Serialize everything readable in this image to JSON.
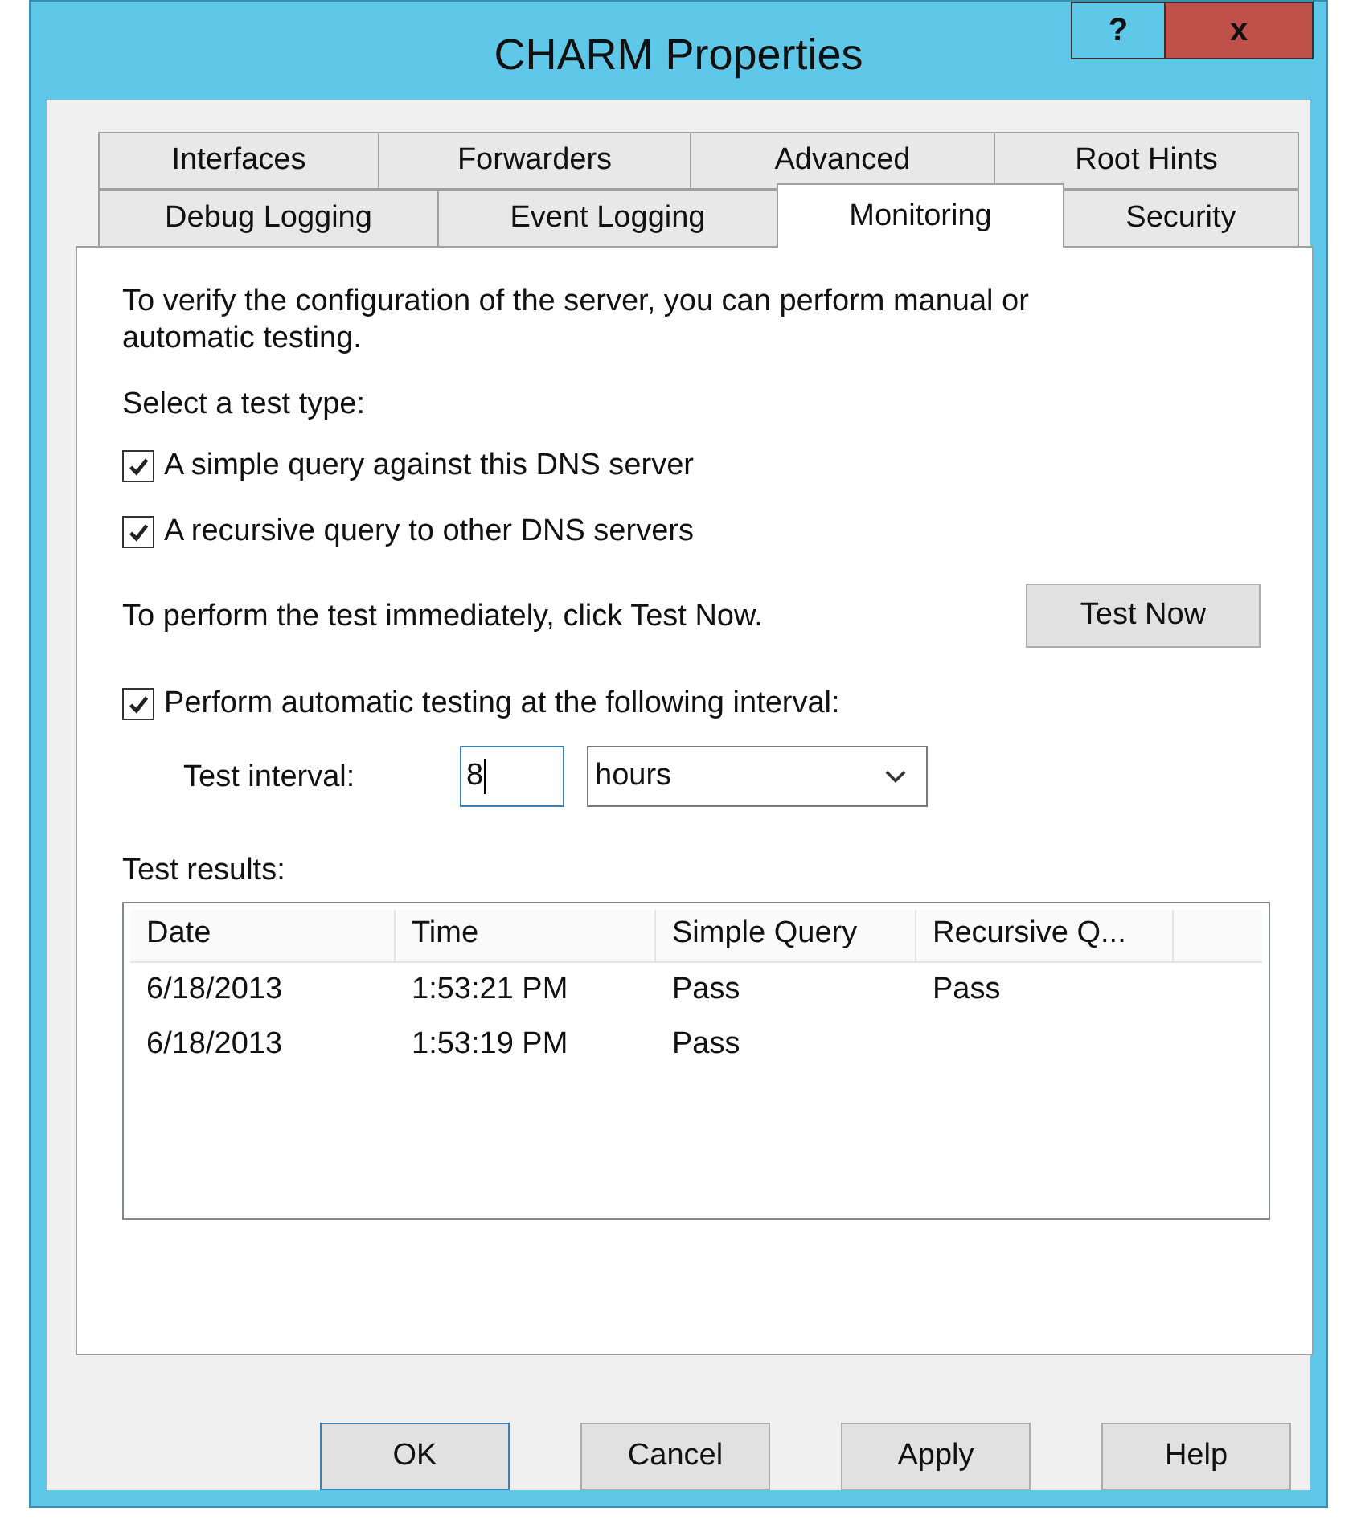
{
  "window": {
    "title": "CHARM Properties",
    "help_label": "?",
    "close_label": "x"
  },
  "tab_rows": [
    [
      {
        "label": "Interfaces",
        "selected": false
      },
      {
        "label": "Forwarders",
        "selected": false
      },
      {
        "label": "Advanced",
        "selected": false
      },
      {
        "label": "Root Hints",
        "selected": false
      }
    ],
    [
      {
        "label": "Debug Logging",
        "selected": false
      },
      {
        "label": "Event Logging",
        "selected": false
      },
      {
        "label": "Monitoring",
        "selected": true
      },
      {
        "label": "Security",
        "selected": false
      }
    ]
  ],
  "intro": "To verify the configuration of the server, you can perform manual or automatic testing.",
  "test_type_label": "Select a test type:",
  "test_types": [
    {
      "label": "A simple query against this DNS server",
      "checked": true
    },
    {
      "label": "A recursive query to other DNS servers",
      "checked": true
    }
  ],
  "test_now_text": "To perform the test immediately, click Test Now.",
  "test_now_button": "Test Now",
  "automatic": {
    "label": "Perform automatic testing at the following interval:",
    "checked": true
  },
  "interval": {
    "label": "Test interval:",
    "value": "8",
    "unit": "hours"
  },
  "results_label": "Test results:",
  "table": {
    "columns": [
      "Date",
      "Time",
      "Simple Query",
      "Recursive Q..."
    ],
    "rows": [
      [
        "6/18/2013",
        "1:53:21 PM",
        "Pass",
        "Pass"
      ],
      [
        "6/18/2013",
        "1:53:19 PM",
        "Pass",
        ""
      ]
    ]
  },
  "buttons": [
    "OK",
    "Cancel",
    "Apply",
    "Help"
  ]
}
